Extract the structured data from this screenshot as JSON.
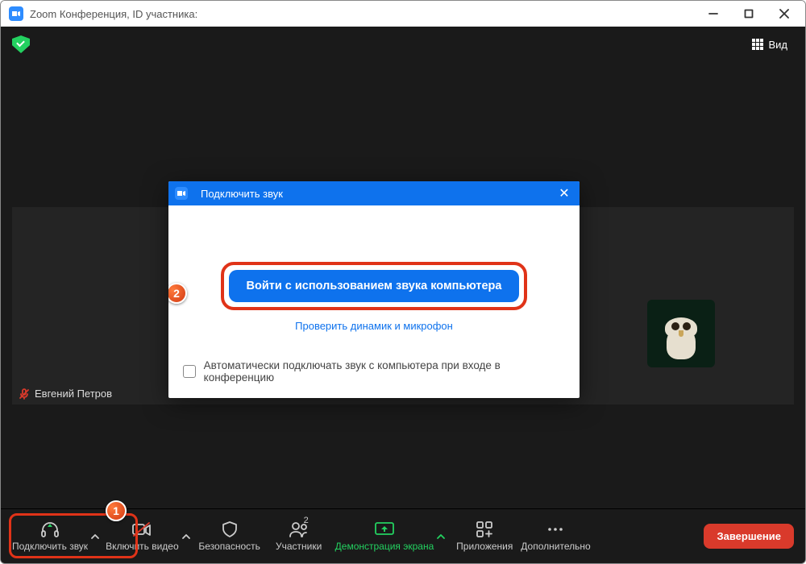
{
  "titlebar": {
    "title": "Zoom Конференция, ID участника:"
  },
  "topbar": {
    "view_label": "Вид"
  },
  "participant": {
    "name": "Евгений Петров"
  },
  "bottombar": {
    "items": [
      {
        "label": "Подключить звук"
      },
      {
        "label": "Включить видео"
      },
      {
        "label": "Безопасность"
      },
      {
        "label": "Участники",
        "count": "2"
      },
      {
        "label": "Демонстрация экрана"
      },
      {
        "label": "Приложения"
      },
      {
        "label": "Дополнительно"
      }
    ],
    "end_label": "Завершение"
  },
  "dialog": {
    "title": "Подключить звук",
    "join_button": "Войти с использованием звука компьютера",
    "test_link": "Проверить динамик и микрофон",
    "auto_join_label": "Автоматически подключать звук с компьютера при входе в конференцию"
  },
  "annotations": [
    "1",
    "2"
  ],
  "colors": {
    "accent": "#0e72ed",
    "green": "#23d160",
    "danger": "#d93a2b",
    "highlight": "#e03318"
  }
}
